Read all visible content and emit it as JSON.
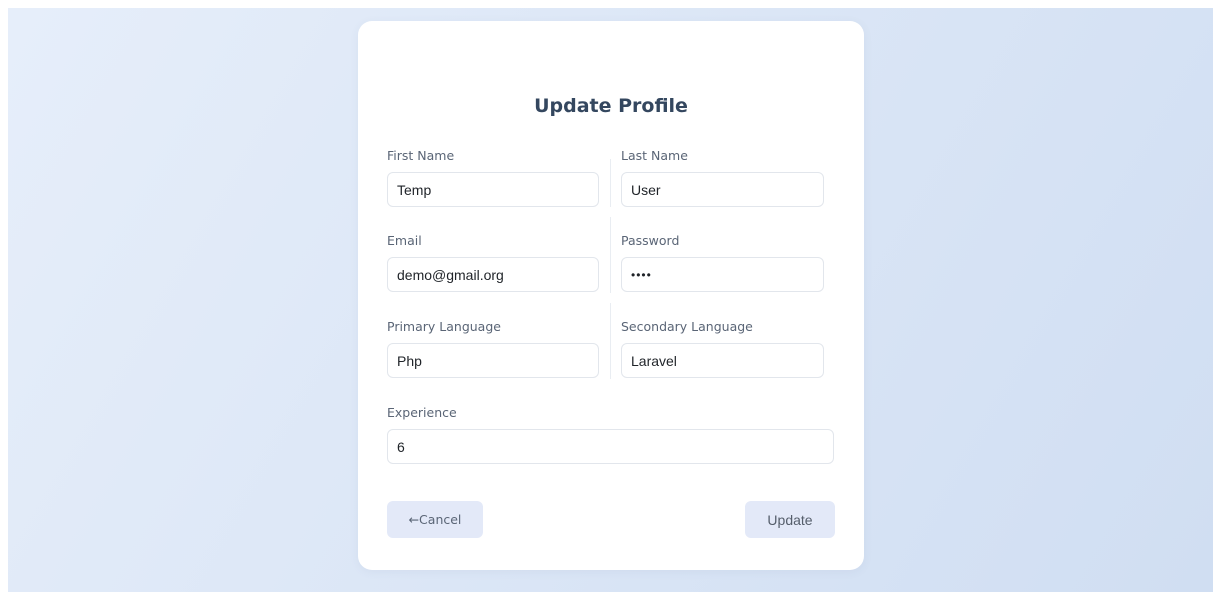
{
  "form": {
    "title": "Update Profile",
    "fields": {
      "first_name": {
        "label": "First Name",
        "value": "Temp"
      },
      "last_name": {
        "label": "Last Name",
        "value": "User"
      },
      "email": {
        "label": "Email",
        "value": "demo@gmail.org"
      },
      "password": {
        "label": "Password",
        "value": "demo"
      },
      "primary_language": {
        "label": "Primary Language",
        "value": "Php"
      },
      "secondary_language": {
        "label": "Secondary Language",
        "value": "Laravel"
      },
      "experience": {
        "label": "Experience",
        "value": "6"
      }
    },
    "buttons": {
      "cancel_label": "←Cancel",
      "update_label": "Update"
    }
  },
  "colors": {
    "background_start": "#e6eefa",
    "background_end": "#d0def2",
    "card": "#ffffff",
    "title": "#34475f",
    "button_bg": "#e3e9f8"
  }
}
